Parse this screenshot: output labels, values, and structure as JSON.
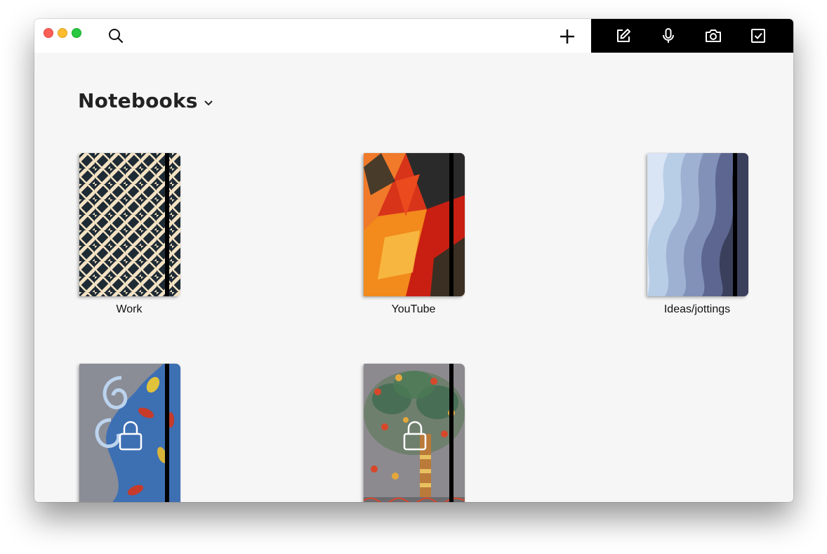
{
  "window": {
    "traffic_lights": [
      "close",
      "minimize",
      "zoom"
    ]
  },
  "toolbar": {
    "search_icon": "search-icon",
    "add_icon": "plus-icon",
    "quick_actions": [
      {
        "name": "new-note",
        "icon": "compose-icon"
      },
      {
        "name": "audio-note",
        "icon": "microphone-icon"
      },
      {
        "name": "photo-note",
        "icon": "camera-icon"
      },
      {
        "name": "checklist-note",
        "icon": "checkbox-icon"
      }
    ]
  },
  "main": {
    "heading": "Notebooks",
    "heading_dropdown_icon": "chevron-down-icon",
    "notebooks": [
      {
        "title": "Work",
        "cover": "geometric-maze-pattern",
        "locked": false
      },
      {
        "title": "YouTube",
        "cover": "red-orange-abstract",
        "locked": false
      },
      {
        "title": "Ideas/jottings",
        "cover": "blue-wave-gradient",
        "locked": false
      },
      {
        "title": "",
        "cover": "blue-wave-fish-art",
        "locked": true
      },
      {
        "title": "",
        "cover": "tree-folk-art",
        "locked": true
      }
    ]
  },
  "colors": {
    "background": "#f6f6f6",
    "toolbar_accent": "#000000",
    "text": "#222222"
  }
}
